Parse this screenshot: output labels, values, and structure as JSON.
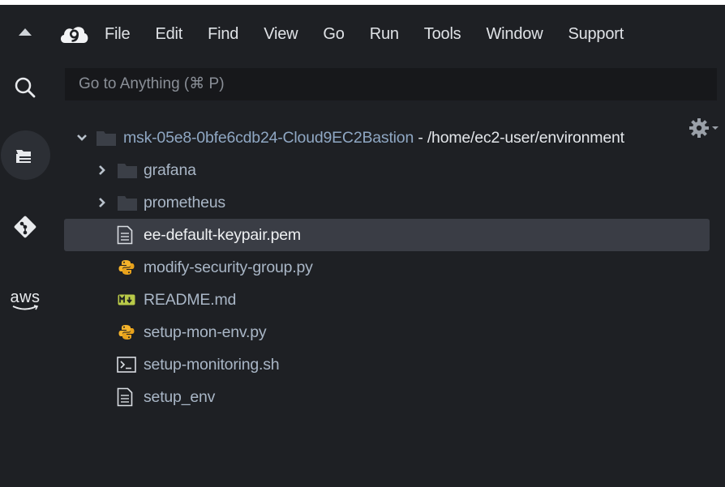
{
  "menu": {
    "items": [
      "File",
      "Edit",
      "Find",
      "View",
      "Go",
      "Run",
      "Tools",
      "Window",
      "Support"
    ]
  },
  "search": {
    "placeholder": "Go to Anything (⌘ P)"
  },
  "sidebar": {
    "aws_label": "aws"
  },
  "tree": {
    "root_name": "msk-05e8-0bfe6cdb24-Cloud9EC2Bastion",
    "root_path": " - /home/ec2-user/environment",
    "folders": [
      "grafana",
      "prometheus"
    ],
    "files": [
      {
        "name": "ee-default-keypair.pem",
        "icon": "text-file-icon",
        "selected": true
      },
      {
        "name": "modify-security-group.py",
        "icon": "python-file-icon"
      },
      {
        "name": "README.md",
        "icon": "markdown-file-icon"
      },
      {
        "name": "setup-mon-env.py",
        "icon": "python-file-icon"
      },
      {
        "name": "setup-monitoring.sh",
        "icon": "terminal-file-icon"
      },
      {
        "name": "setup_env",
        "icon": "text-file-icon"
      }
    ]
  },
  "colors": {
    "background": "#1e2024",
    "selected_row": "#3a3d45",
    "python_icon": "#f5b32a",
    "markdown_icon": "#b8c948",
    "root_label": "#8fa7c3"
  }
}
